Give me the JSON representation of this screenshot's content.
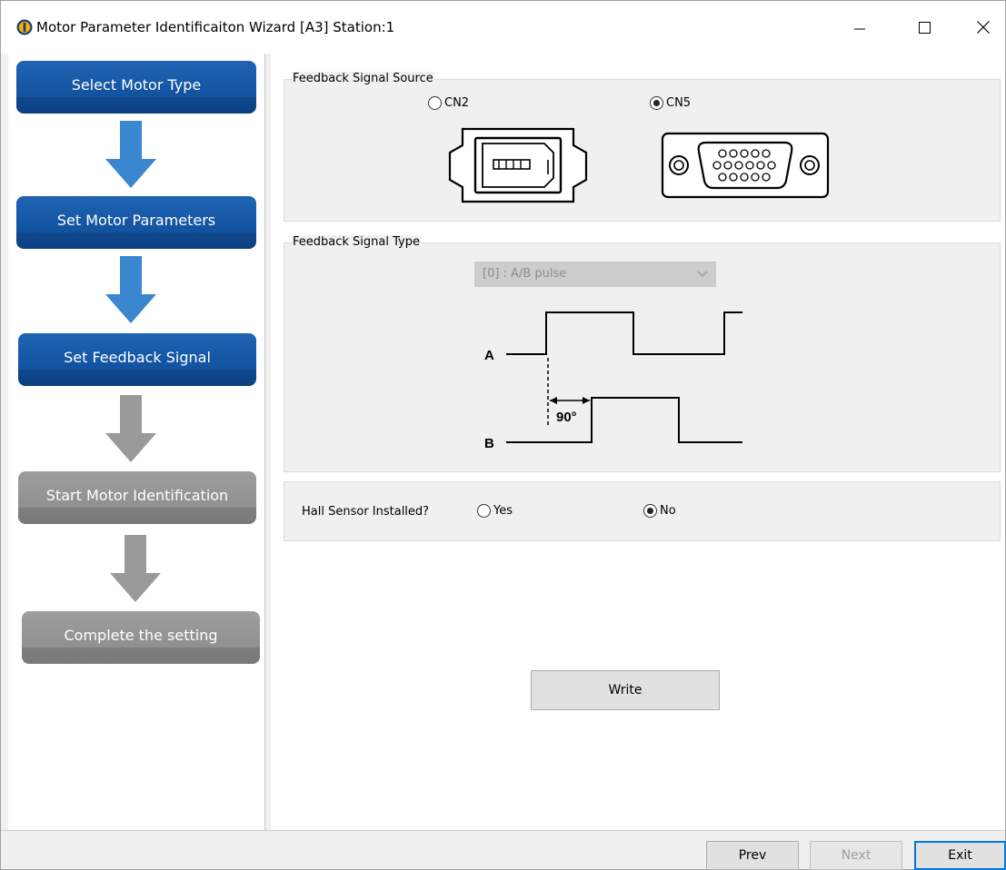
{
  "window": {
    "title": "Motor Parameter Identificaiton Wizard [A3] Station:1"
  },
  "steps": [
    {
      "label": "Select Motor Type",
      "state": "done"
    },
    {
      "label": "Set Motor Parameters",
      "state": "done"
    },
    {
      "label": "Set Feedback Signal",
      "state": "current"
    },
    {
      "label": "Start Motor Identification",
      "state": "pending"
    },
    {
      "label": "Complete the setting",
      "state": "pending"
    }
  ],
  "feedback_source": {
    "legend": "Feedback Signal Source",
    "options": [
      {
        "label": "CN2",
        "selected": false
      },
      {
        "label": "CN5",
        "selected": true
      }
    ]
  },
  "feedback_type": {
    "legend": "Feedback Signal Type",
    "select_value": "[0] : A/B pulse",
    "diagram": {
      "label_a": "A",
      "label_b": "B",
      "phase": "90°"
    }
  },
  "hall": {
    "question": "Hall Sensor Installed?",
    "options": [
      {
        "label": "Yes",
        "selected": false
      },
      {
        "label": "No",
        "selected": true
      }
    ]
  },
  "buttons": {
    "write": "Write",
    "prev": "Prev",
    "next": "Next",
    "exit": "Exit"
  },
  "colors": {
    "step_done": "#0c4a96",
    "step_pending": "#8a8a8a",
    "arrow_done": "#3a87d0",
    "arrow_pending": "#9a9a9a",
    "accent_focus": "#0078d7"
  }
}
